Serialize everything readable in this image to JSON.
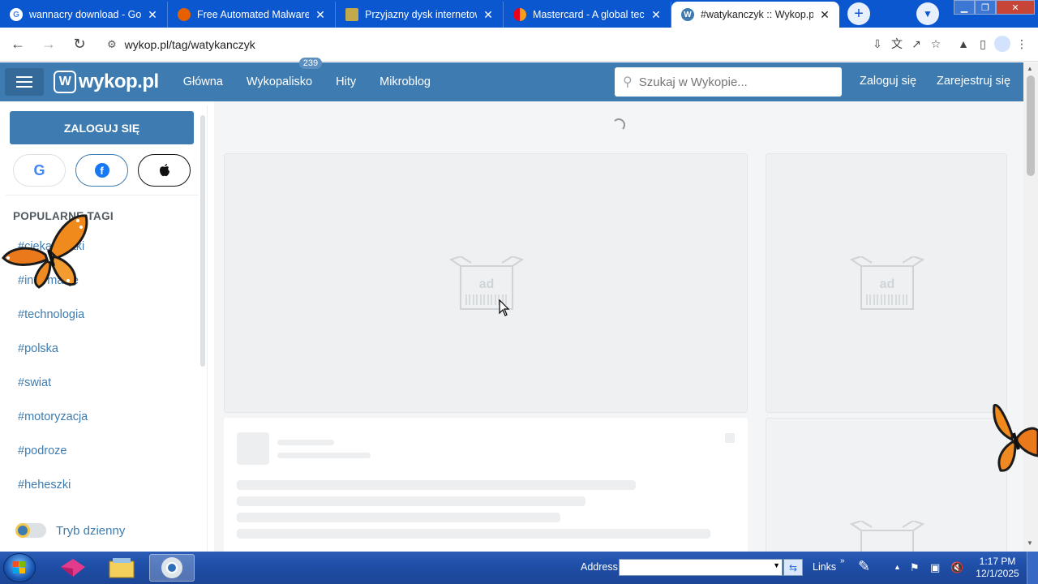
{
  "browser": {
    "tabs": [
      {
        "title": "wannacry download - Goo",
        "favicon": "google-icon",
        "fav_color": "#fff",
        "active": false
      },
      {
        "title": "Free Automated Malware",
        "favicon": "firefox-icon",
        "fav_color": "#e66000",
        "active": false
      },
      {
        "title": "Przyjazny dysk internetow",
        "favicon": "file-icon",
        "fav_color": "#c2a94b",
        "active": false
      },
      {
        "title": "Mastercard - A global tec",
        "favicon": "mastercard-icon",
        "fav_color": "#eb001b",
        "active": false
      },
      {
        "title": "#watykanczyk :: Wykop.pl",
        "favicon": "wykop-icon",
        "fav_color": "#3d7bb0",
        "active": true
      }
    ],
    "url": "wykop.pl/tag/watykanczyk",
    "accent": "#0b57d0"
  },
  "wykop": {
    "logo_text": "wykop.pl",
    "nav": [
      {
        "label": "Główna"
      },
      {
        "label": "Wykopalisko",
        "badge": "239"
      },
      {
        "label": "Hity"
      },
      {
        "label": "Mikroblog"
      }
    ],
    "search_placeholder": "Szukaj w Wykopie...",
    "login_link": "Zaloguj się",
    "register_link": "Zarejestruj się",
    "brand_color": "#3d7bb0"
  },
  "sidebar": {
    "login_button": "ZALOGUJ SIĘ",
    "social": [
      "google-icon",
      "facebook-icon",
      "apple-icon"
    ],
    "popular_header": "POPULARNE TAGI",
    "tags": [
      "#ciekawostki",
      "#informacje",
      "#technologia",
      "#polska",
      "#swiat",
      "#motoryzacja",
      "#podroze",
      "#heheszki"
    ],
    "day_mode": "Tryb dzienny"
  },
  "main": {
    "ad_label": "ad"
  },
  "taskbar": {
    "address_label": "Address",
    "links_label": "Links",
    "time": "1:17 PM",
    "date": "12/1/2025"
  }
}
